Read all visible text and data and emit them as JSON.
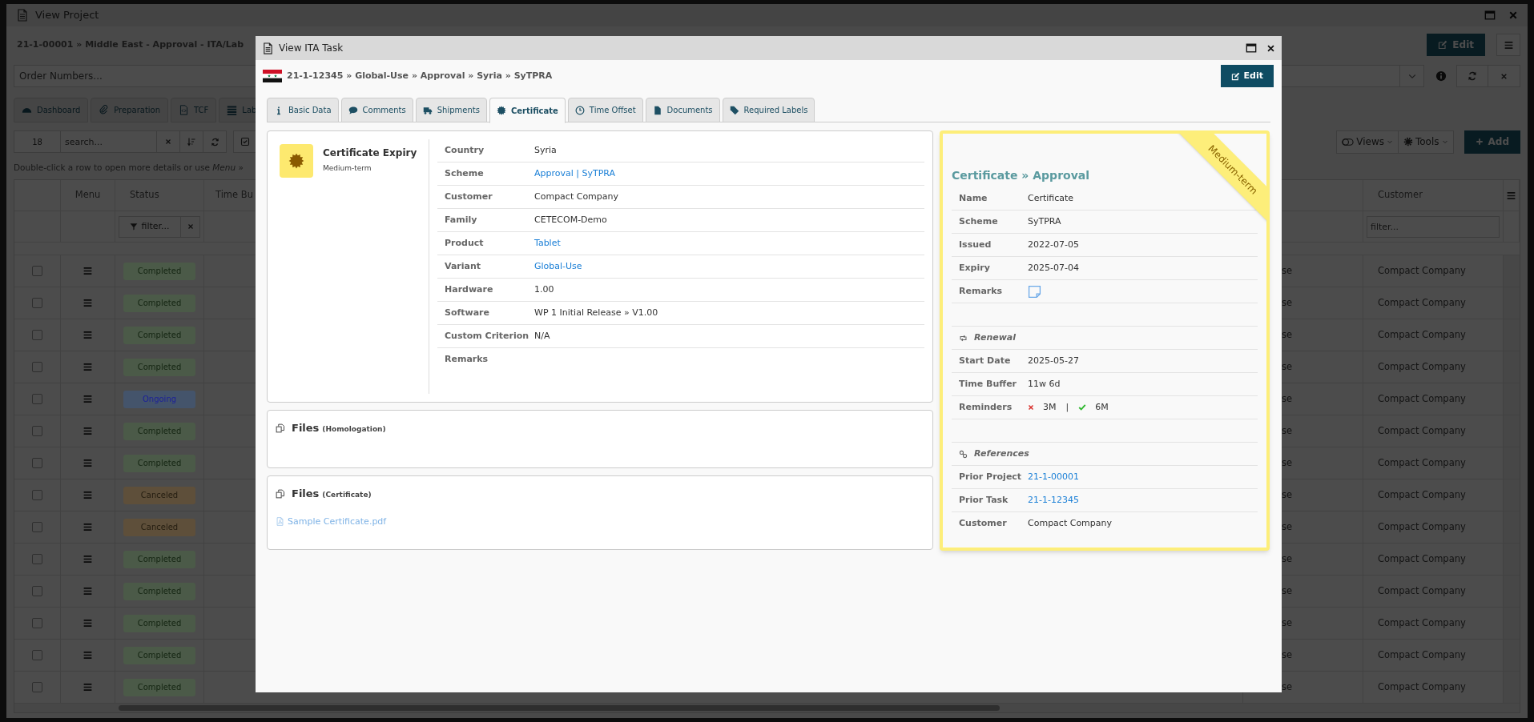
{
  "background_window": {
    "title": "View Project",
    "breadcrumb": "21-1-00001 » Middle East - Approval - ITA/Lab",
    "edit_button": "Edit",
    "order_numbers": {
      "placeholder": "Order Numbers..."
    },
    "tabs": [
      {
        "label": "Dashboard"
      },
      {
        "label": "Preparation"
      },
      {
        "label": "TCF"
      },
      {
        "label": "Lab"
      }
    ],
    "page_size": "18",
    "search": {
      "placeholder": "search..."
    },
    "views_button": "Views",
    "tools_button": "Tools",
    "add_button": "Add",
    "hint": "Double-click a row to open more details or use *Menu* »",
    "table": {
      "columns": [
        "Menu",
        "Status",
        "Time Bu",
        "Customer"
      ],
      "status_filter": {
        "label": "filter..."
      },
      "customer_filter": {
        "placeholder": "filter..."
      },
      "rows": [
        {
          "checked": false,
          "status": "Completed",
          "color": "#4b5a48",
          "column_5": "se",
          "customer": "Compact Company"
        },
        {
          "checked": false,
          "status": "Completed",
          "color": "#4b5a48",
          "column_5": "se",
          "customer": "Compact Company"
        },
        {
          "checked": false,
          "status": "Completed",
          "color": "#4b5a48",
          "column_5": "se",
          "customer": "Compact Company"
        },
        {
          "checked": false,
          "status": "Completed",
          "color": "#4b5a48",
          "column_5": "se",
          "customer": "Compact Company"
        },
        {
          "checked": false,
          "status": "Ongoing",
          "color": "#44546b",
          "column_5": "se",
          "customer": "Compact Company"
        },
        {
          "checked": false,
          "status": "Completed",
          "color": "#4b5a48",
          "column_5": "se",
          "customer": "Compact Company"
        },
        {
          "checked": false,
          "status": "Completed",
          "color": "#4b5a48",
          "column_5": "se",
          "customer": "Compact Company"
        },
        {
          "checked": false,
          "status": "Canceled",
          "color": "#5e4f3a",
          "column_5": "se",
          "customer": "Compact Company"
        },
        {
          "checked": false,
          "status": "Canceled",
          "color": "#5e4f3a",
          "column_5": "se",
          "customer": "Compact Company"
        },
        {
          "checked": false,
          "status": "Completed",
          "color": "#4b5a48",
          "column_5": "se",
          "customer": "Compact Company"
        },
        {
          "checked": false,
          "status": "Completed",
          "color": "#4b5a48",
          "column_5": "se",
          "customer": "Compact Company"
        },
        {
          "checked": false,
          "status": "Completed",
          "color": "#4b5a48",
          "column_5": "se",
          "customer": "Compact Company"
        },
        {
          "checked": false,
          "status": "Completed",
          "color": "#4b5a48",
          "column_5": "se",
          "customer": "Compact Company"
        },
        {
          "checked": false,
          "status": "Completed",
          "color": "#4b5a48",
          "column_5": "se",
          "customer": "Compact Company"
        }
      ]
    }
  },
  "dialog": {
    "title": "View ITA Task",
    "breadcrumb": "21-1-12345 » Global-Use » Approval » Syria » SyTPRA",
    "edit_button": "Edit",
    "tabs": [
      {
        "label": "Basic Data",
        "selected": false
      },
      {
        "label": "Comments",
        "selected": false
      },
      {
        "label": "Shipments",
        "selected": false
      },
      {
        "label": "Certificate",
        "selected": true
      },
      {
        "label": "Time Offset",
        "selected": false
      },
      {
        "label": "Documents",
        "selected": false
      },
      {
        "label": "Required Labels",
        "selected": false
      }
    ],
    "summary": {
      "title": "Certificate Expiry",
      "subtitle": "Medium-term"
    },
    "details": [
      {
        "label": "Country",
        "value": "Syria",
        "kind": "text"
      },
      {
        "label": "Scheme",
        "value": "Approval | SyTPRA",
        "kind": "link"
      },
      {
        "label": "Customer",
        "value": "Compact Company",
        "kind": "text"
      },
      {
        "label": "Family",
        "value": "CETECOM-Demo",
        "kind": "text"
      },
      {
        "label": "Product",
        "value": "Tablet",
        "kind": "link"
      },
      {
        "label": "Variant",
        "value": "Global-Use",
        "kind": "link"
      },
      {
        "label": "Hardware",
        "value": "1.00",
        "kind": "text"
      },
      {
        "label": "Software",
        "value": "WP 1 Initial Release » V1.00",
        "kind": "text"
      },
      {
        "label": "Custom Criterion",
        "value": "N/A",
        "kind": "text"
      },
      {
        "label": "Remarks",
        "kind": "text"
      }
    ],
    "files": [
      {
        "title": "Files",
        "qualifier": "(Homologation)"
      },
      {
        "title": "Files",
        "qualifier": "(Certificate)",
        "items": [
          "Sample Certificate.pdf"
        ]
      }
    ],
    "certificate": {
      "ribbon": "Medium-term",
      "title": "Certificate » Approval",
      "rows": [
        {
          "label": "Name",
          "value": "Certificate",
          "kind": "text"
        },
        {
          "label": "Scheme",
          "value": "SyTPRA",
          "kind": "text"
        },
        {
          "label": "Issued",
          "value": "2022-07-05",
          "kind": "text"
        },
        {
          "label": "Expiry",
          "value": "2025-07-04",
          "kind": "text"
        },
        {
          "label": "Remarks",
          "kind": "note"
        }
      ],
      "renewal": {
        "heading": "Renewal",
        "rows": [
          {
            "label": "Start Date",
            "value": "2025-05-27",
            "kind": "text"
          },
          {
            "label": "Time Buffer",
            "value": "11w 6d",
            "kind": "text"
          }
        ],
        "reminders": {
          "label": "Reminders",
          "separator": "|",
          "items": [
            {
              "label": "3M",
              "done": false
            },
            {
              "label": "6M",
              "done": true
            }
          ]
        }
      },
      "references": {
        "heading": "References",
        "rows": [
          {
            "label": "Prior Project",
            "value": "21-1-00001",
            "kind": "link"
          },
          {
            "label": "Prior Task",
            "value": "21-1-12345",
            "kind": "link"
          },
          {
            "label": "Customer",
            "value": "Compact Company",
            "kind": "text"
          }
        ]
      }
    }
  }
}
